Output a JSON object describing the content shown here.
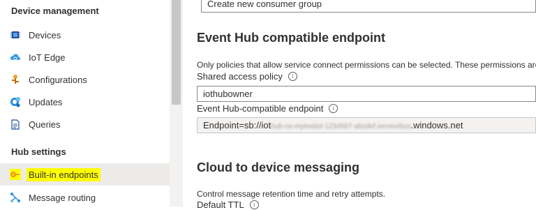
{
  "sidebar": {
    "device_management_title": "Device management",
    "hub_settings_title": "Hub settings",
    "items": [
      {
        "label": "Devices",
        "icon": "chip-icon"
      },
      {
        "label": "IoT Edge",
        "icon": "cloud-icon"
      },
      {
        "label": "Configurations",
        "icon": "configuration-icon"
      },
      {
        "label": "Updates",
        "icon": "updates-icon"
      },
      {
        "label": "Queries",
        "icon": "document-icon"
      },
      {
        "label": "Built-in endpoints",
        "icon": "endpoint-icon",
        "active": true,
        "highlighted": true
      },
      {
        "label": "Message routing",
        "icon": "routing-icon"
      }
    ]
  },
  "main": {
    "consumer_group_placeholder": "Create new consumer group",
    "event_hub_title": "Event Hub compatible endpoint",
    "policy_note": "Only policies that allow service connect permissions can be selected. These permissions are a",
    "shared_access_policy_label": "Shared access policy",
    "shared_access_policy_value": "iothubowner",
    "endpoint_label": "Event Hub-compatible endpoint",
    "endpoint_prefix": "Endpoint=sb://iot",
    "endpoint_obscured": "hub-ns-mytestiot-1234567-abcdef.servicebus",
    "endpoint_suffix": ".windows.net",
    "c2d_title": "Cloud to device messaging",
    "c2d_note": "Control message retention time and retry attempts.",
    "default_ttl_label": "Default TTL"
  },
  "colors": {
    "highlight": "#ffff00",
    "active_bg": "#edebe9",
    "accent_blue": "#0078d4"
  }
}
